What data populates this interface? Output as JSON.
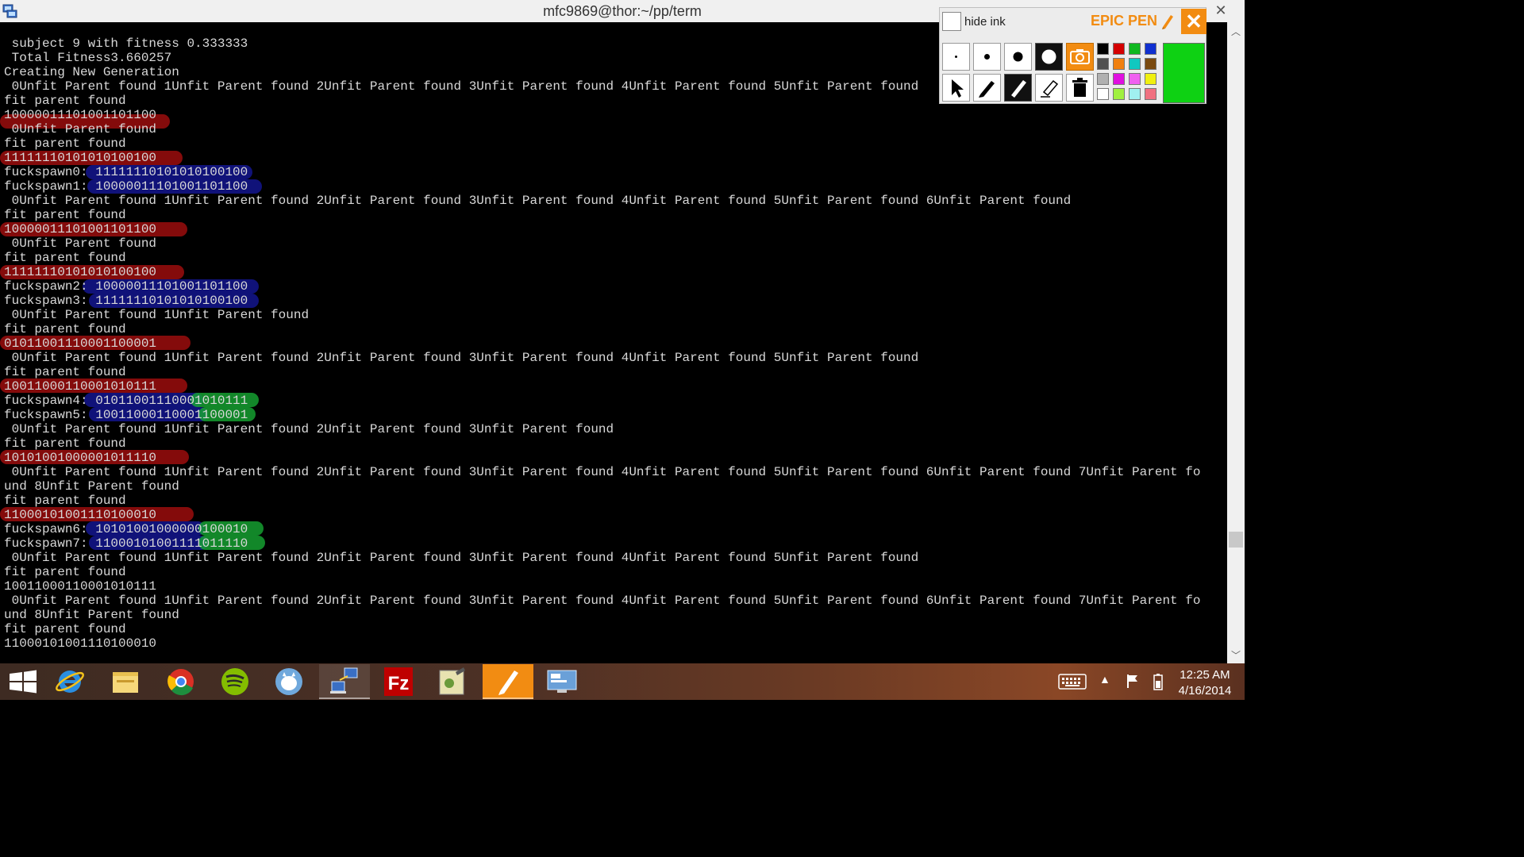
{
  "window": {
    "title": "mfc9869@thor:~/pp/term",
    "close_glyph": "✕"
  },
  "terminal": {
    "lines": [
      {
        "text": " subject 9 with fitness 0.333333"
      },
      {
        "text": " Total Fitness3.660257"
      },
      {
        "text": "Creating New Generation"
      },
      {
        "text": " 0Unfit Parent found 1Unfit Parent found 2Unfit Parent found 3Unfit Parent found 4Unfit Parent found 5Unfit Parent found"
      },
      {
        "text": "fit parent found"
      },
      {
        "text": "10000011101001101100"
      },
      {
        "text": " 0Unfit Parent found"
      },
      {
        "text": "fit parent found"
      },
      {
        "text": "11111110101010100100"
      },
      {
        "text": "fuckspawn0: 11111110101010100100"
      },
      {
        "text": "fuckspawn1: 10000011101001101100"
      },
      {
        "text": " 0Unfit Parent found 1Unfit Parent found 2Unfit Parent found 3Unfit Parent found 4Unfit Parent found 5Unfit Parent found 6Unfit Parent found"
      },
      {
        "text": "fit parent found"
      },
      {
        "text": "10000011101001101100"
      },
      {
        "text": " 0Unfit Parent found"
      },
      {
        "text": "fit parent found"
      },
      {
        "text": "11111110101010100100"
      },
      {
        "text": "fuckspawn2: 10000011101001101100"
      },
      {
        "text": "fuckspawn3: 11111110101010100100"
      },
      {
        "text": " 0Unfit Parent found 1Unfit Parent found"
      },
      {
        "text": "fit parent found"
      },
      {
        "text": "01011001110001100001"
      },
      {
        "text": " 0Unfit Parent found 1Unfit Parent found 2Unfit Parent found 3Unfit Parent found 4Unfit Parent found 5Unfit Parent found"
      },
      {
        "text": "fit parent found"
      },
      {
        "text": "10011000110001010111"
      },
      {
        "text": "fuckspawn4: 01011001110001010111"
      },
      {
        "text": "fuckspawn5: 10011000110001100001"
      },
      {
        "text": " 0Unfit Parent found 1Unfit Parent found 2Unfit Parent found 3Unfit Parent found"
      },
      {
        "text": "fit parent found"
      },
      {
        "text": "10101001000001011110"
      },
      {
        "text": " 0Unfit Parent found 1Unfit Parent found 2Unfit Parent found 3Unfit Parent found 4Unfit Parent found 5Unfit Parent found 6Unfit Parent found 7Unfit Parent fo"
      },
      {
        "text": "und 8Unfit Parent found"
      },
      {
        "text": "fit parent found"
      },
      {
        "text": "11000101001110100010"
      },
      {
        "text": "fuckspawn6: 10101001000000100010"
      },
      {
        "text": "fuckspawn7: 11000101001111011110"
      },
      {
        "text": " 0Unfit Parent found 1Unfit Parent found 2Unfit Parent found 3Unfit Parent found 4Unfit Parent found 5Unfit Parent found"
      },
      {
        "text": "fit parent found"
      },
      {
        "text": "10011000110001010111"
      },
      {
        "text": " 0Unfit Parent found 1Unfit Parent found 2Unfit Parent found 3Unfit Parent found 4Unfit Parent found 5Unfit Parent found 6Unfit Parent found 7Unfit Parent fo"
      },
      {
        "text": "und 8Unfit Parent found"
      },
      {
        "text": "fit parent found"
      },
      {
        "text": "11000101001110100010"
      }
    ]
  },
  "epic_pen": {
    "hide_ink_label": "hide ink",
    "hide_ink_checked": false,
    "brand": "EPIC PEN",
    "close_glyph": "✕",
    "brush_sizes": [
      "tiny",
      "small",
      "medium",
      "large"
    ],
    "tools": [
      "pointer-icon",
      "pen-icon",
      "highlighter-icon",
      "eraser-icon",
      "trash-icon"
    ],
    "snapshot_icon": "camera-icon",
    "palette": [
      "#000000",
      "#d40000",
      "#10b820",
      "#1030d0",
      "#505050",
      "#f08010",
      "#10c8c0",
      "#7a4a10",
      "#b0b0b0",
      "#e010e0",
      "#f060f0",
      "#f0f010",
      "#ffffff",
      "#a0f040",
      "#a0f0f0",
      "#f07080"
    ],
    "selected_color": "#0ed113"
  },
  "taskbar": {
    "apps": [
      {
        "name": "start-button",
        "icon": "windows-logo-icon"
      },
      {
        "name": "internet-explorer",
        "icon": "internet-explorer-icon"
      },
      {
        "name": "file-explorer",
        "icon": "folder-icon"
      },
      {
        "name": "chrome",
        "icon": "chrome-icon"
      },
      {
        "name": "spotify",
        "icon": "spotify-icon"
      },
      {
        "name": "messenger",
        "icon": "chat-icon"
      },
      {
        "name": "ssh-client",
        "icon": "network-computers-icon"
      },
      {
        "name": "filezilla",
        "icon": "filezilla-icon"
      },
      {
        "name": "gimp",
        "icon": "image-editor-icon"
      },
      {
        "name": "epic-pen",
        "icon": "pen-icon"
      },
      {
        "name": "remote-desktop",
        "icon": "remote-desktop-icon"
      }
    ],
    "tray": {
      "keyboard_icon": "keyboard-icon",
      "show_hidden_glyph": "▲",
      "flag_icon": "action-center-flag-icon",
      "battery_icon": "battery-icon"
    },
    "time": "12:25 AM",
    "date": "4/16/2014"
  },
  "scrollbar": {
    "up_glyph": "︿",
    "down_glyph": "﹀"
  }
}
